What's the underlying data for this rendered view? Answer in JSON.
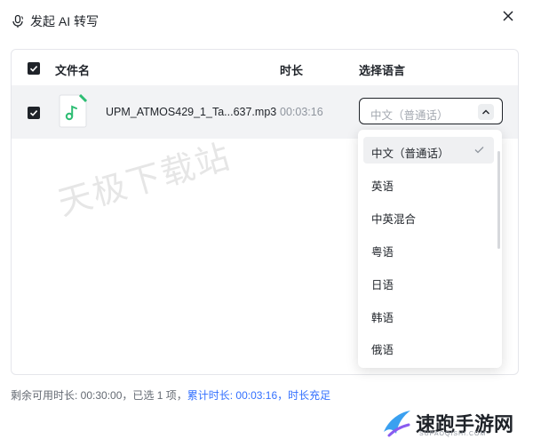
{
  "header": {
    "title": "发起 AI 转写",
    "icon": "microphone-icon",
    "close_icon": "close-icon"
  },
  "table": {
    "columns": [
      "文件名",
      "时长",
      "选择语言"
    ],
    "rows": [
      {
        "checked": true,
        "file_name": "UPM_ATMOS429_1_Ta...637.mp3",
        "duration": "00:03:16",
        "language": "中文（普通话）"
      }
    ]
  },
  "language_dropdown": {
    "selected": "中文（普通话）",
    "options": [
      "中文（普通话）",
      "英语",
      "中英混合",
      "粤语",
      "日语",
      "韩语",
      "俄语"
    ]
  },
  "watermark": "天极下载站",
  "footer": {
    "remaining": "剩余可用时长: 00:30:00，已选 1 项，",
    "total": "累计时长: 00:03:16，时长充足"
  },
  "brand": {
    "name": "速跑手游网",
    "url": "SUPAOQISHI.COM"
  },
  "colors": {
    "accent": "#3370ff",
    "checkbox": "#1f2329",
    "music_icon": "#2dbd73"
  }
}
